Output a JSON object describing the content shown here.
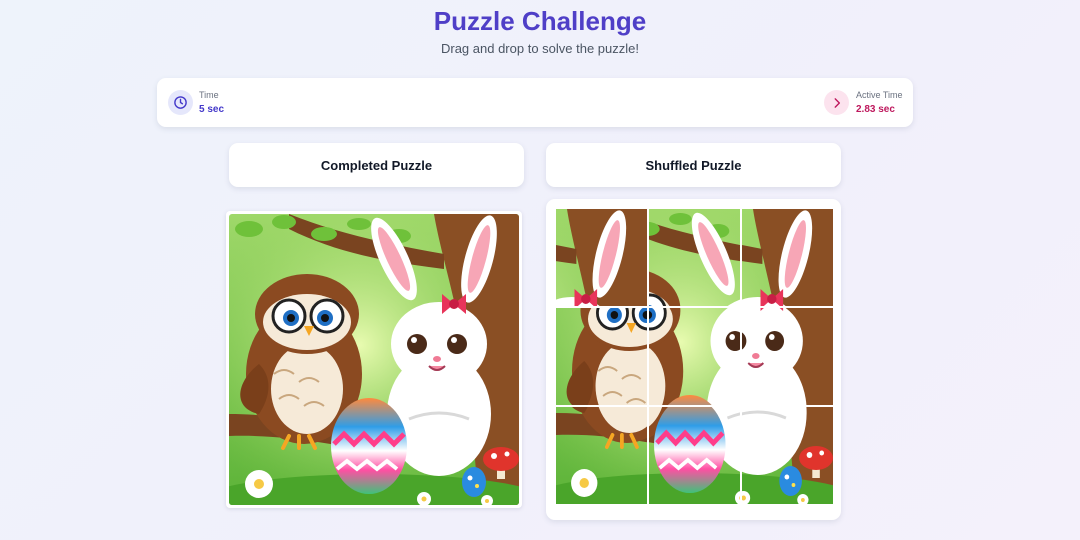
{
  "header": {
    "title": "Puzzle Challenge",
    "subtitle": "Drag and drop to solve the puzzle!"
  },
  "stats": {
    "time_label": "Time",
    "time_value": "5 sec",
    "time_icon": "clock-icon",
    "active_label": "Active Time",
    "active_value": "2.83 sec",
    "active_icon": "chevron-right-icon"
  },
  "panels": {
    "completed_title": "Completed Puzzle",
    "shuffled_title": "Shuffled Puzzle"
  },
  "puzzle": {
    "grid": 3,
    "image_alt": "Cartoon owl with glasses and white bunny with pink bow next to a decorated Easter egg",
    "shuffled_order": [
      2,
      1,
      2,
      3,
      4,
      5,
      6,
      7,
      8
    ]
  },
  "colors": {
    "accent": "#4f3fc7",
    "active_accent": "#be185d"
  }
}
